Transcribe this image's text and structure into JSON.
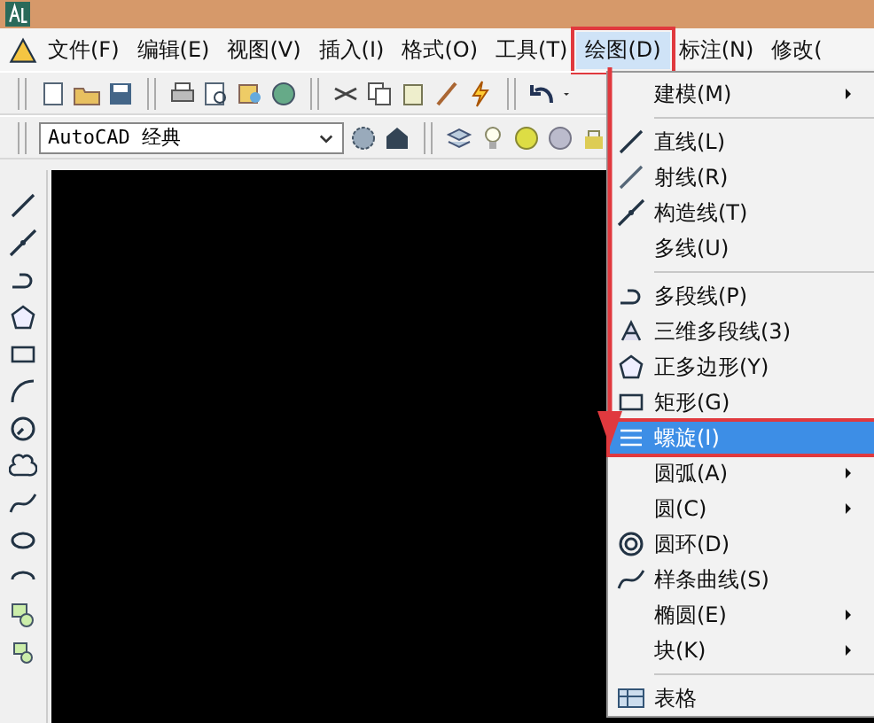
{
  "menubar": {
    "items": [
      {
        "label": "文件(F)",
        "selected": false
      },
      {
        "label": "编辑(E)",
        "selected": false
      },
      {
        "label": "视图(V)",
        "selected": false
      },
      {
        "label": "插入(I)",
        "selected": false
      },
      {
        "label": "格式(O)",
        "selected": false
      },
      {
        "label": "工具(T)",
        "selected": false
      },
      {
        "label": "绘图(D)",
        "selected": true
      },
      {
        "label": "标注(N)",
        "selected": false
      },
      {
        "label": "修改(",
        "selected": false
      }
    ]
  },
  "workspace_combo": {
    "value": "AutoCAD 经典"
  },
  "draw_menu": {
    "items": [
      {
        "kind": "item",
        "label": "建模(M)",
        "submenu": true,
        "selected": false
      },
      {
        "kind": "separator"
      },
      {
        "kind": "item",
        "label": "直线(L)",
        "submenu": false,
        "selected": false
      },
      {
        "kind": "item",
        "label": "射线(R)",
        "submenu": false,
        "selected": false
      },
      {
        "kind": "item",
        "label": "构造线(T)",
        "submenu": false,
        "selected": false
      },
      {
        "kind": "item",
        "label": "多线(U)",
        "submenu": false,
        "selected": false
      },
      {
        "kind": "separator"
      },
      {
        "kind": "item",
        "label": "多段线(P)",
        "submenu": false,
        "selected": false
      },
      {
        "kind": "item",
        "label": "三维多段线(3)",
        "submenu": false,
        "selected": false
      },
      {
        "kind": "item",
        "label": "正多边形(Y)",
        "submenu": false,
        "selected": false
      },
      {
        "kind": "item",
        "label": "矩形(G)",
        "submenu": false,
        "selected": false
      },
      {
        "kind": "item",
        "label": "螺旋(I)",
        "submenu": false,
        "selected": true
      },
      {
        "kind": "item",
        "label": "圆弧(A)",
        "submenu": true,
        "selected": false
      },
      {
        "kind": "item",
        "label": "圆(C)",
        "submenu": true,
        "selected": false
      },
      {
        "kind": "item",
        "label": "圆环(D)",
        "submenu": false,
        "selected": false
      },
      {
        "kind": "item",
        "label": "样条曲线(S)",
        "submenu": false,
        "selected": false
      },
      {
        "kind": "item",
        "label": "椭圆(E)",
        "submenu": true,
        "selected": false
      },
      {
        "kind": "item",
        "label": "块(K)",
        "submenu": true,
        "selected": false
      },
      {
        "kind": "separator"
      },
      {
        "kind": "item",
        "label": "表格",
        "submenu": false,
        "selected": false
      }
    ]
  }
}
